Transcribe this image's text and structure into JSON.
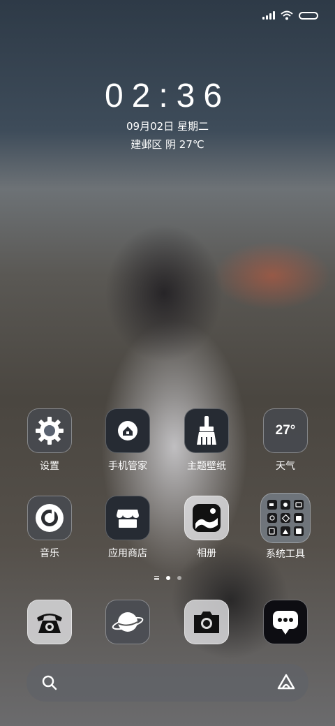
{
  "status": {
    "signal_bars": 4,
    "wifi": "wifi-icon",
    "battery": "battery-icon"
  },
  "clock": {
    "time": "02:36",
    "date": "09月02日 星期二",
    "location_weather": "建邺区 阴 27℃"
  },
  "apps_row1": [
    {
      "label": "设置",
      "icon": "gear-icon"
    },
    {
      "label": "手机管家",
      "icon": "shield-home-icon"
    },
    {
      "label": "主题壁纸",
      "icon": "paintbrush-icon"
    },
    {
      "label": "天气",
      "icon": "weather-icon",
      "badge": "27°"
    }
  ],
  "apps_row2": [
    {
      "label": "音乐",
      "icon": "music-disc-icon"
    },
    {
      "label": "应用商店",
      "icon": "store-icon"
    },
    {
      "label": "相册",
      "icon": "gallery-icon"
    },
    {
      "label": "系统工具",
      "icon": "folder-grid-icon"
    }
  ],
  "pager": {
    "pages": 2,
    "current": 1
  },
  "dock": [
    {
      "name": "phone",
      "icon": "phone-icon"
    },
    {
      "name": "browser",
      "icon": "planet-icon"
    },
    {
      "name": "camera",
      "icon": "camera-icon"
    },
    {
      "name": "messages",
      "icon": "message-icon"
    }
  ],
  "search": {
    "left_icon": "search-icon",
    "right_icon": "assistant-icon"
  }
}
